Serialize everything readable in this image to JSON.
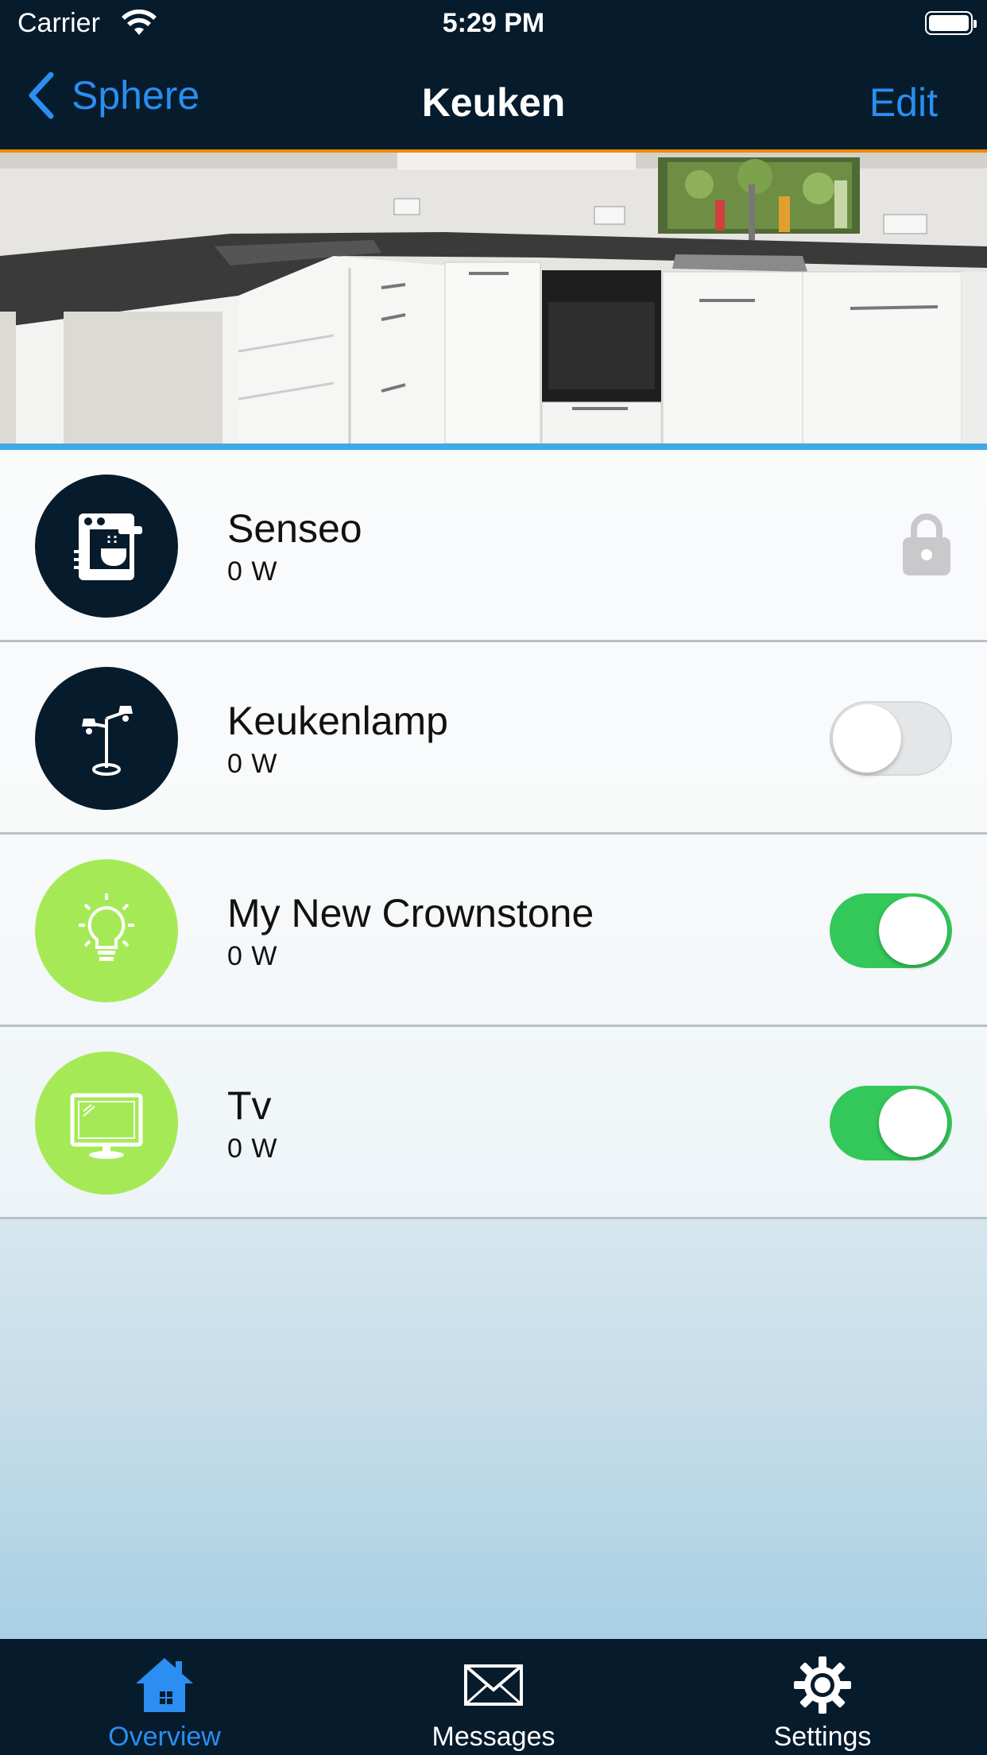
{
  "status_bar": {
    "carrier": "Carrier",
    "time": "5:29 PM"
  },
  "nav": {
    "back_label": "Sphere",
    "title": "Keuken",
    "edit_label": "Edit"
  },
  "devices": [
    {
      "name": "Senseo",
      "power": "0 W",
      "icon": "coffee-machine-icon",
      "control": "locked"
    },
    {
      "name": "Keukenlamp",
      "power": "0 W",
      "icon": "floor-lamp-icon",
      "control": "toggle",
      "on": false
    },
    {
      "name": "My New Crownstone",
      "power": "0 W",
      "icon": "light-bulb-icon",
      "control": "toggle",
      "on": true
    },
    {
      "name": "Tv",
      "power": "0 W",
      "icon": "tv-icon",
      "control": "toggle",
      "on": true
    }
  ],
  "tabs": [
    {
      "label": "Overview",
      "icon": "home-icon",
      "active": true
    },
    {
      "label": "Messages",
      "icon": "envelope-icon",
      "active": false
    },
    {
      "label": "Settings",
      "icon": "gear-icon",
      "active": false
    }
  ],
  "colors": {
    "nav_bg": "#061b2c",
    "accent": "#2b8ef0",
    "nav_border": "#f08a00",
    "toggle_on": "#34c759",
    "icon_green": "#a5ea56"
  }
}
